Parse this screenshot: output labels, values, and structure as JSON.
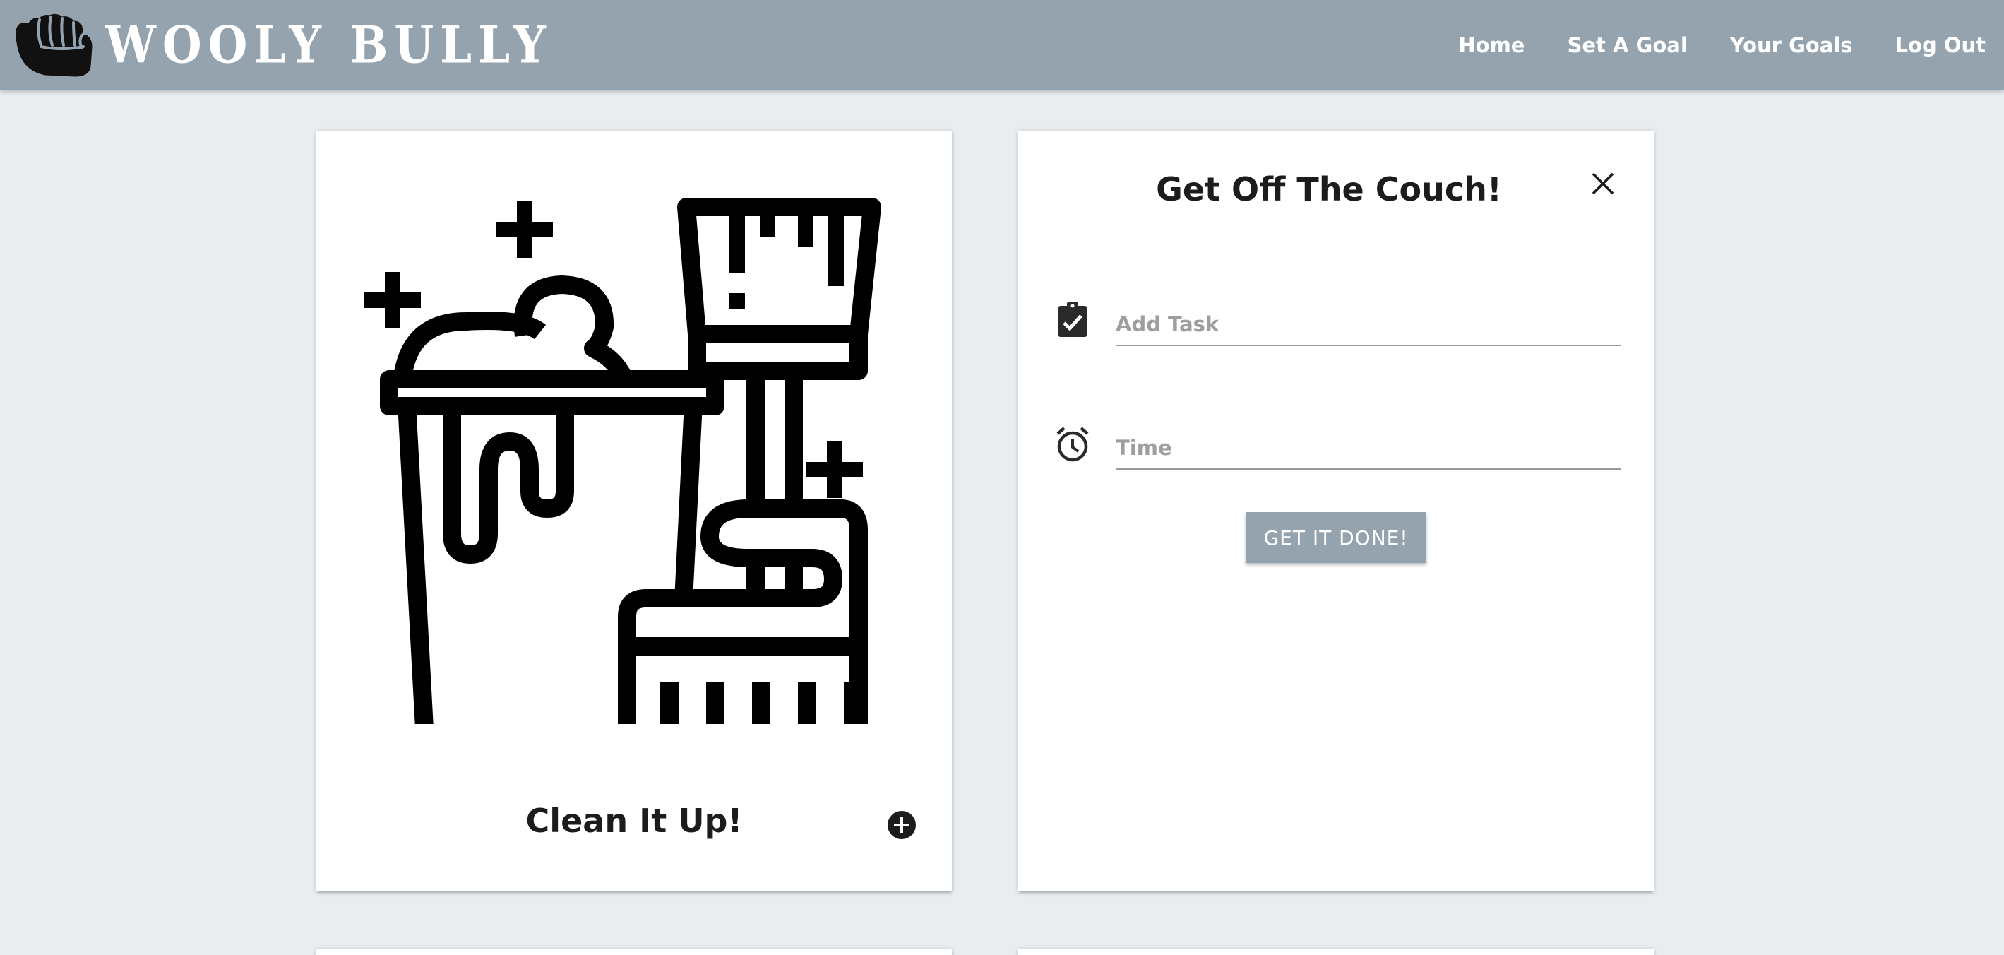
{
  "brand": {
    "name": "WOOLY BULLY",
    "logo_icon": "fist-icon"
  },
  "nav": {
    "links": [
      {
        "label": "Home"
      },
      {
        "label": "Set A Goal"
      },
      {
        "label": "Your Goals"
      },
      {
        "label": "Log Out"
      }
    ]
  },
  "cards": {
    "clean": {
      "title": "Clean It Up!",
      "illustration": "cleaning-bucket-broom-icon",
      "action_icon": "add-circle-icon"
    },
    "couch": {
      "title": "Get Off The Couch!",
      "close_icon": "close-icon",
      "task_placeholder": "Add Task",
      "task_value": "",
      "time_placeholder": "Time",
      "time_value": "",
      "submit_label": "GET IT DONE!"
    }
  },
  "colors": {
    "navbar": "#95a3ae",
    "background": "#e9edf0",
    "button": "#95a3ae",
    "card": "#ffffff"
  }
}
